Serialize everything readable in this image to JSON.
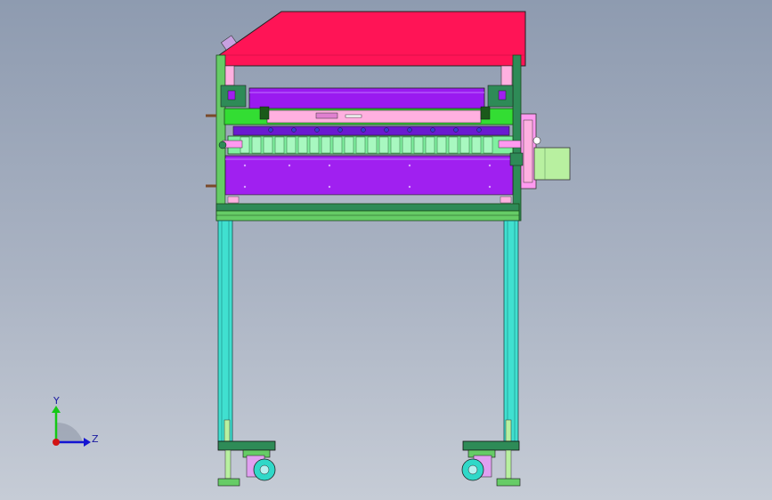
{
  "view": {
    "background_top": "#8e9bb0",
    "background_bottom": "#c6ccd6"
  },
  "triad": {
    "y_label": "Y",
    "z_label": "Z",
    "y_color": "#14c814",
    "z_color": "#1414d2",
    "x_color": "#d21414"
  },
  "model": {
    "colors": {
      "cover": "#ff1456",
      "frame": "#2e8b57",
      "frame_light": "#66cc66",
      "roller": "#9a1af0",
      "plate": "#a020f0",
      "bracket": "#33dd33",
      "leg": "#40e0d0",
      "motor": "#b8f0a0",
      "motor_plate": "#ff9af0",
      "caster": "#e0a0f0",
      "wheel": "#30d8c8",
      "pink": "#ffb0e0",
      "shaft": "#80f0a0"
    }
  }
}
